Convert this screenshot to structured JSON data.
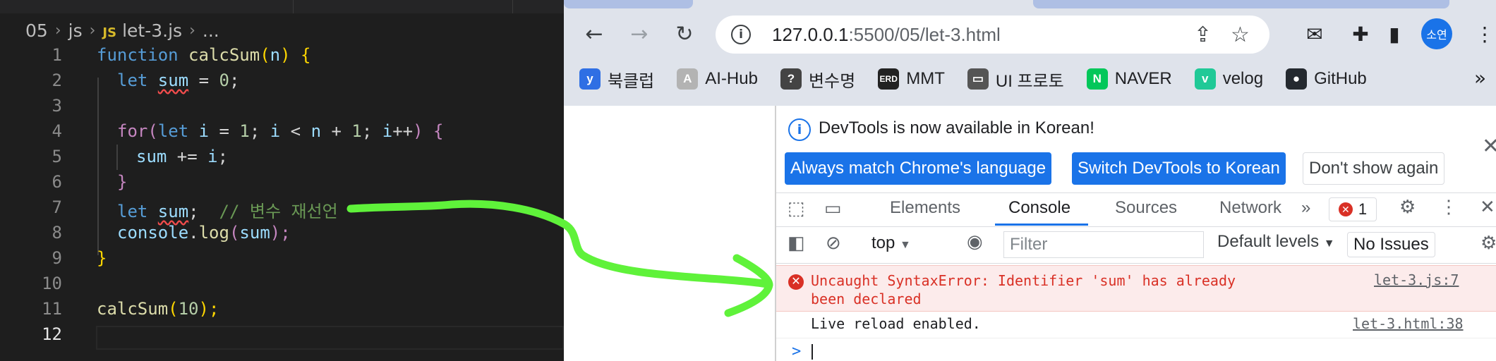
{
  "editor": {
    "breadcrumb": [
      "05",
      "js",
      "let-3.js",
      "..."
    ],
    "file_badge": "JS",
    "active_line": "12",
    "lines": [
      {
        "n": "1",
        "parts": [
          {
            "t": "function ",
            "c": "kw"
          },
          {
            "t": "calcSum",
            "c": "fn"
          },
          {
            "t": "(",
            "c": "by"
          },
          {
            "t": "n",
            "c": "var"
          },
          {
            "t": ") {",
            "c": "by"
          }
        ]
      },
      {
        "n": "2",
        "parts": [
          {
            "t": "let ",
            "c": "kw"
          },
          {
            "t": "sum",
            "c": "var sq"
          },
          {
            "t": " = ",
            "c": "tx"
          },
          {
            "t": "0",
            "c": "num"
          },
          {
            "t": ";",
            "c": "tx"
          }
        ]
      },
      {
        "n": "3",
        "parts": []
      },
      {
        "n": "4",
        "parts": [
          {
            "t": "for",
            "c": "pu"
          },
          {
            "t": "(",
            "c": "pu"
          },
          {
            "t": "let ",
            "c": "kw"
          },
          {
            "t": "i",
            "c": "var"
          },
          {
            "t": " = ",
            "c": "tx"
          },
          {
            "t": "1",
            "c": "num"
          },
          {
            "t": "; ",
            "c": "tx"
          },
          {
            "t": "i",
            "c": "var"
          },
          {
            "t": " < ",
            "c": "tx"
          },
          {
            "t": "n",
            "c": "var"
          },
          {
            "t": " + ",
            "c": "tx"
          },
          {
            "t": "1",
            "c": "num"
          },
          {
            "t": "; ",
            "c": "tx"
          },
          {
            "t": "i",
            "c": "var"
          },
          {
            "t": "++",
            "c": "tx"
          },
          {
            "t": ") {",
            "c": "pu"
          }
        ]
      },
      {
        "n": "5",
        "parts": [
          {
            "t": "sum",
            "c": "var"
          },
          {
            "t": " += ",
            "c": "tx"
          },
          {
            "t": "i",
            "c": "var"
          },
          {
            "t": ";",
            "c": "tx"
          }
        ]
      },
      {
        "n": "6",
        "parts": [
          {
            "t": "}",
            "c": "pu"
          }
        ]
      },
      {
        "n": "7",
        "parts": [
          {
            "t": "let ",
            "c": "kw"
          },
          {
            "t": "sum",
            "c": "var sq"
          },
          {
            "t": ";  ",
            "c": "tx"
          },
          {
            "t": "// 변수 재선언",
            "c": "cm"
          }
        ]
      },
      {
        "n": "8",
        "parts": [
          {
            "t": "console",
            "c": "var"
          },
          {
            "t": ".",
            "c": "tx"
          },
          {
            "t": "log",
            "c": "fn"
          },
          {
            "t": "(",
            "c": "pu"
          },
          {
            "t": "sum",
            "c": "var"
          },
          {
            "t": ");",
            "c": "pu"
          }
        ]
      },
      {
        "n": "9",
        "parts": [
          {
            "t": "}",
            "c": "by"
          }
        ]
      },
      {
        "n": "10",
        "parts": []
      },
      {
        "n": "11",
        "parts": [
          {
            "t": "calcSum",
            "c": "fn"
          },
          {
            "t": "(",
            "c": "by"
          },
          {
            "t": "10",
            "c": "num"
          },
          {
            "t": ");",
            "c": "by"
          }
        ]
      },
      {
        "n": "12",
        "parts": []
      }
    ]
  },
  "browser": {
    "url_host": "127.0.0.1",
    "url_rest": ":5500/05/let-3.html",
    "avatar": "소연",
    "bookmarks": [
      {
        "label": "북클럽",
        "icon": "y",
        "color": "#2f6fe4"
      },
      {
        "label": "AI-Hub",
        "icon": "A",
        "color": "#b3b3b3"
      },
      {
        "label": "변수명",
        "icon": "?",
        "color": "#444444"
      },
      {
        "label": "MMT",
        "icon": "ERD",
        "color": "#222222"
      },
      {
        "label": "UI 프로토",
        "icon": "▭",
        "color": "#555555"
      },
      {
        "label": "NAVER",
        "icon": "N",
        "color": "#03c75a"
      },
      {
        "label": "velog",
        "icon": "v",
        "color": "#20c997"
      },
      {
        "label": "GitHub",
        "icon": "●",
        "color": "#24292f"
      }
    ],
    "more": "»"
  },
  "devtools": {
    "notice": "DevTools is now available in Korean!",
    "btn_match": "Always match Chrome's language",
    "btn_switch": "Switch DevTools to Korean",
    "btn_dont": "Don't show again",
    "tabs": [
      "Elements",
      "Console",
      "Sources",
      "Network"
    ],
    "more_tabs": "»",
    "error_count": "1",
    "context": "top",
    "filter_placeholder": "Filter",
    "levels": "Default levels",
    "issues": "No Issues",
    "error_message": "Uncaught SyntaxError: Identifier 'sum' has already been declared",
    "error_source": "let-3.js:7",
    "log_message": "Live reload enabled.",
    "log_source": "let-3.html:38",
    "prompt": ">"
  }
}
